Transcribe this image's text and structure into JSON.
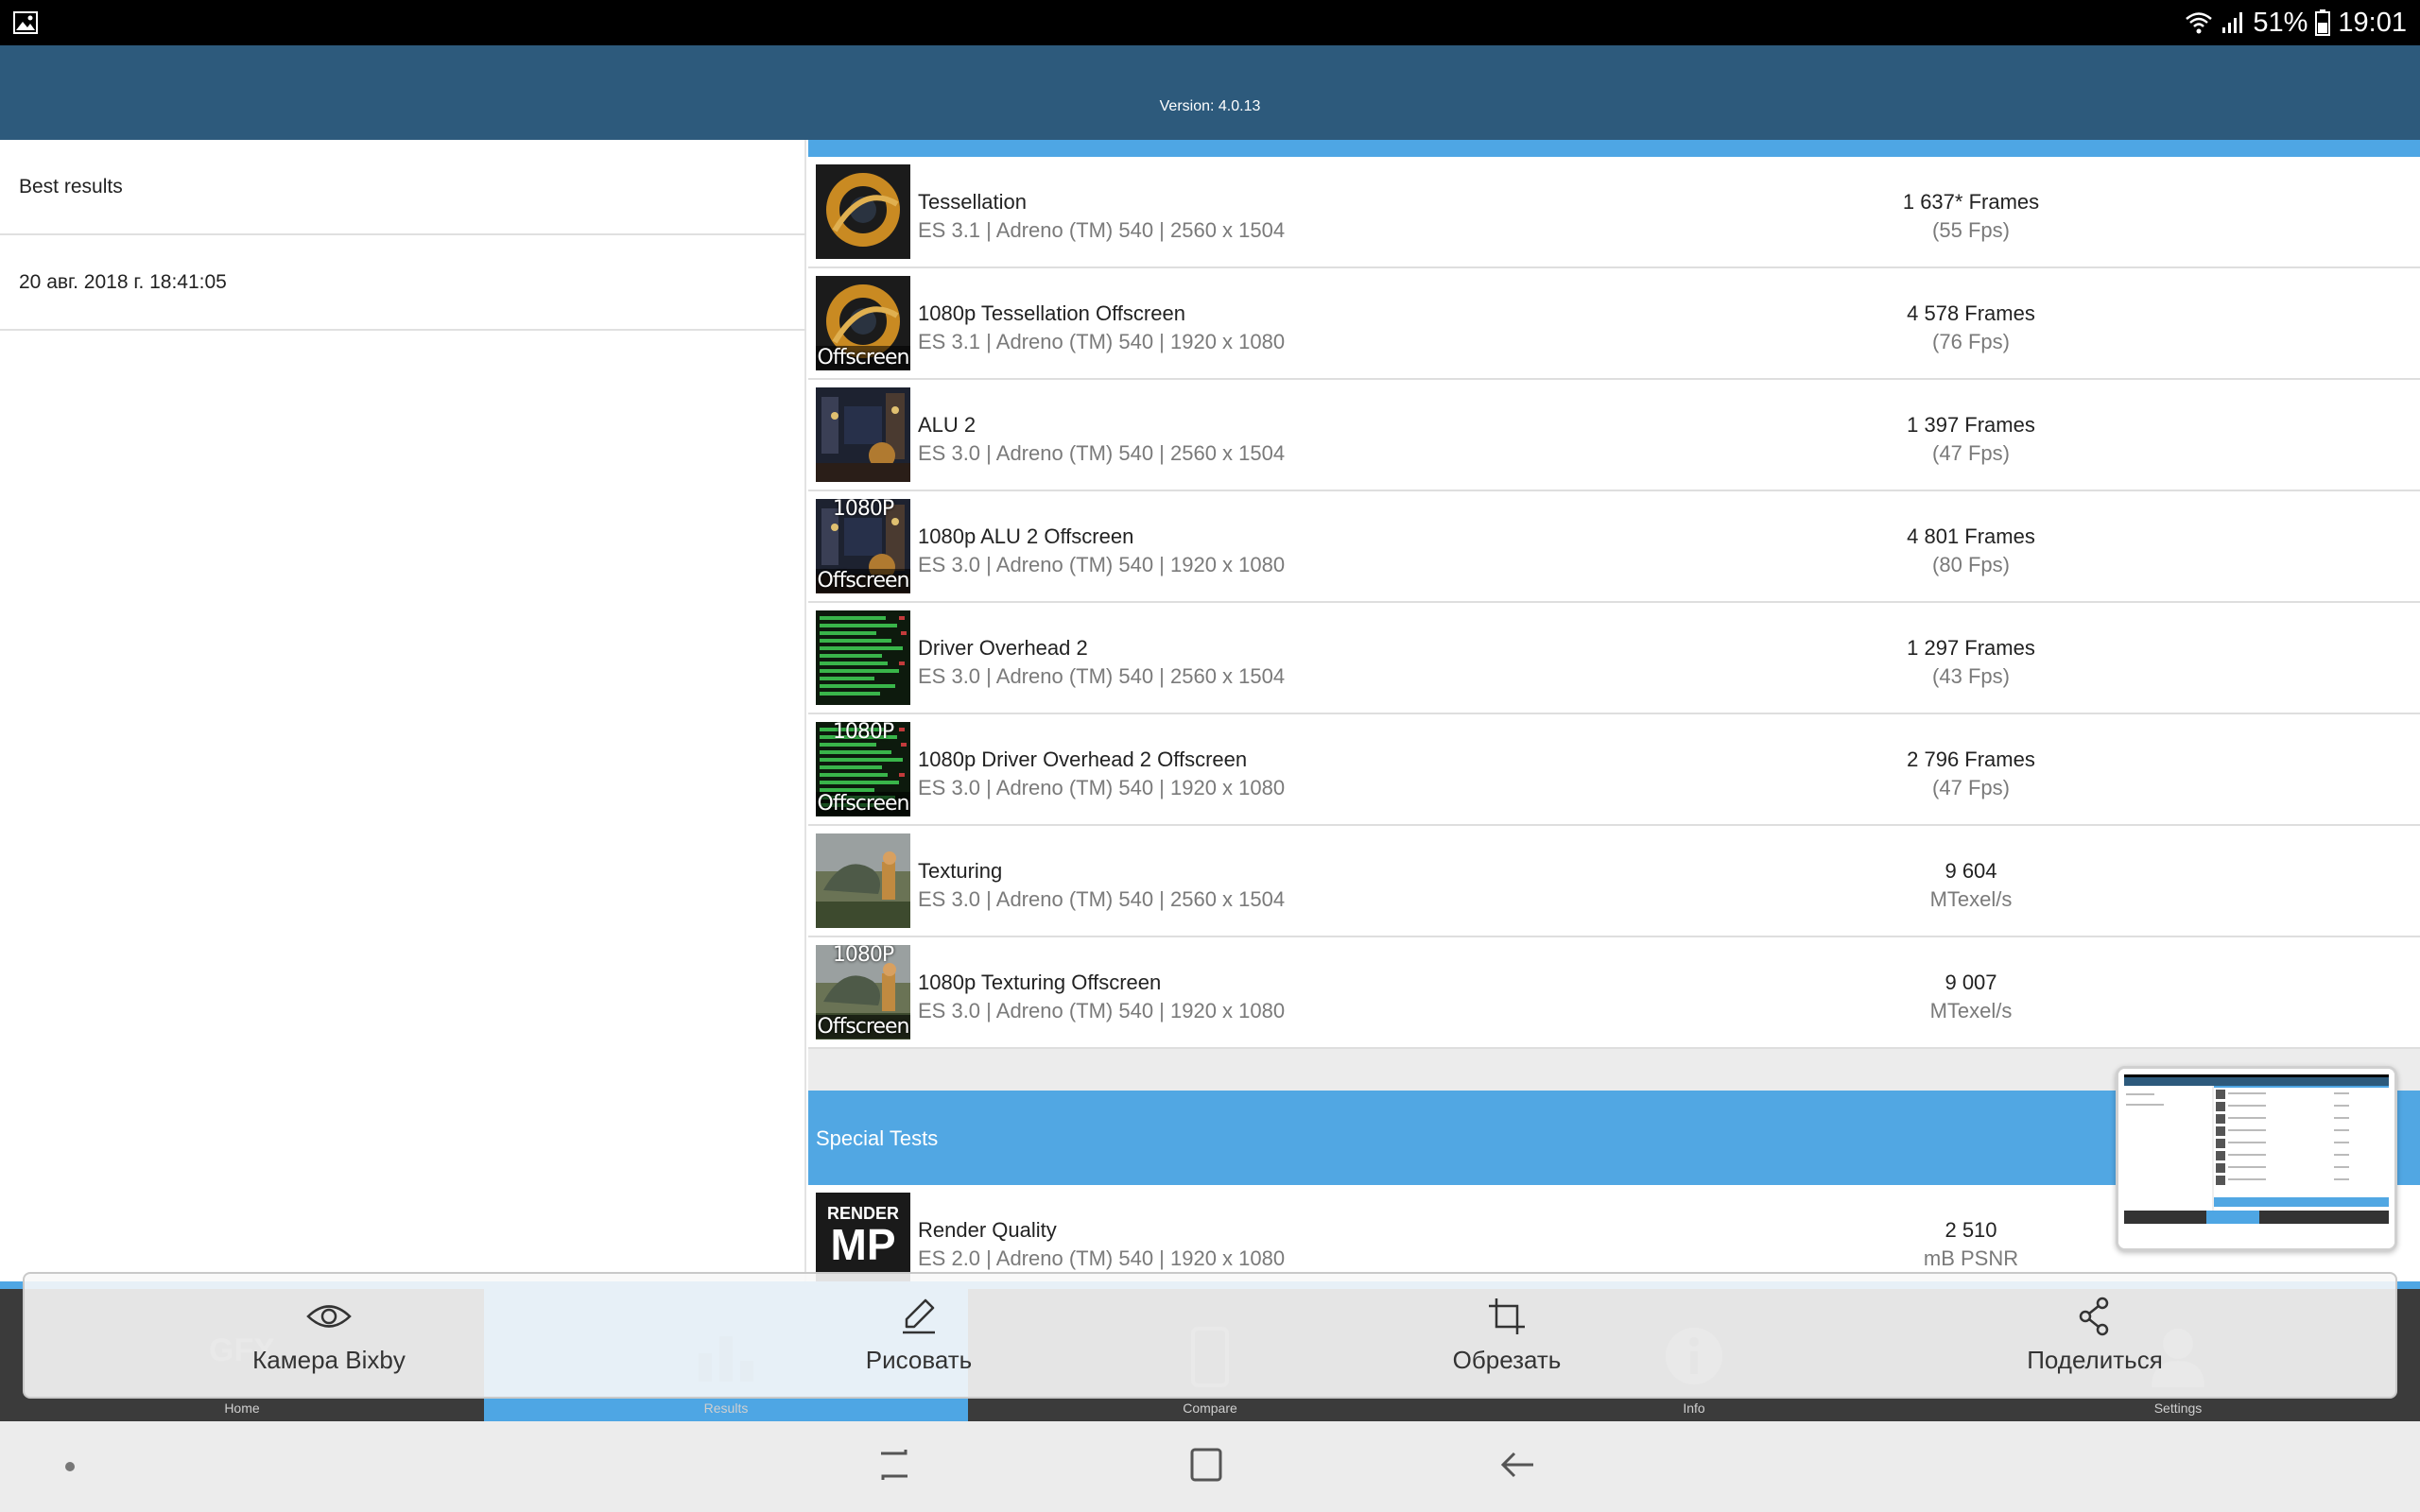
{
  "status_bar": {
    "battery": "51%",
    "time": "19:01",
    "icons": [
      "gallery-icon",
      "wifi-icon",
      "signal-icon",
      "battery-icon"
    ]
  },
  "header": {
    "version": "Version: 4.0.13"
  },
  "left_panel": {
    "title": "Best results",
    "session_date": "20 авг. 2018 г. 18:41:05"
  },
  "tests": [
    {
      "name": "Tessellation",
      "info": "ES 3.1 | Adreno (TM) 540 | 2560 x 1504",
      "score": "1 637* Frames",
      "sub": "(55 Fps)",
      "thumb": "tessellation",
      "thumb_top": "",
      "thumb_bottom": ""
    },
    {
      "name": "1080p Tessellation Offscreen",
      "info": "ES 3.1 | Adreno (TM) 540 | 1920 x 1080",
      "score": "4 578 Frames",
      "sub": "(76 Fps)",
      "thumb": "tessellation",
      "thumb_top": "",
      "thumb_bottom": "Offscreen"
    },
    {
      "name": "ALU 2",
      "info": "ES 3.0 | Adreno (TM) 540 | 2560 x 1504",
      "score": "1 397 Frames",
      "sub": "(47 Fps)",
      "thumb": "alu",
      "thumb_top": "",
      "thumb_bottom": ""
    },
    {
      "name": "1080p ALU 2 Offscreen",
      "info": "ES 3.0 | Adreno (TM) 540 | 1920 x 1080",
      "score": "4 801 Frames",
      "sub": "(80 Fps)",
      "thumb": "alu",
      "thumb_top": "1080P",
      "thumb_bottom": "Offscreen"
    },
    {
      "name": "Driver Overhead 2",
      "info": "ES 3.0 | Adreno (TM) 540 | 2560 x 1504",
      "score": "1 297 Frames",
      "sub": "(43 Fps)",
      "thumb": "driver",
      "thumb_top": "",
      "thumb_bottom": ""
    },
    {
      "name": "1080p Driver Overhead 2 Offscreen",
      "info": "ES 3.0 | Adreno (TM) 540 | 1920 x 1080",
      "score": "2 796 Frames",
      "sub": "(47 Fps)",
      "thumb": "driver",
      "thumb_top": "1080P",
      "thumb_bottom": "Offscreen"
    },
    {
      "name": "Texturing",
      "info": "ES 3.0 | Adreno (TM) 540 | 2560 x 1504",
      "score": "9 604",
      "sub": "MTexel/s",
      "thumb": "texturing",
      "thumb_top": "",
      "thumb_bottom": ""
    },
    {
      "name": "1080p Texturing Offscreen",
      "info": "ES 3.0 | Adreno (TM) 540 | 1920 x 1080",
      "score": "9 007",
      "sub": "MTexel/s",
      "thumb": "texturing",
      "thumb_top": "1080P",
      "thumb_bottom": "Offscreen"
    }
  ],
  "special": {
    "title": "Special Tests",
    "test": {
      "name": "Render Quality",
      "info": "ES 2.0 | Adreno (TM) 540 | 1920 x 1080",
      "score": "2 510",
      "sub": "mB PSNR",
      "thumb_top": "RENDER",
      "thumb_main": "MP"
    }
  },
  "app_nav": {
    "active_index": 1,
    "tabs": [
      {
        "label": "Home",
        "icon": "home-icon"
      },
      {
        "label": "Results",
        "icon": "bar-chart-icon"
      },
      {
        "label": "Compare",
        "icon": "phone-icon"
      },
      {
        "label": "Info",
        "icon": "info-icon"
      },
      {
        "label": "Settings",
        "icon": "user-icon"
      }
    ]
  },
  "screenshot_toolbar": {
    "bixby": "Камера Bixby",
    "draw": "Рисовать",
    "crop": "Обрезать",
    "share": "Поделиться"
  },
  "system_nav": {
    "keys": [
      "dot-icon",
      "recents-icon",
      "home-square-icon",
      "back-icon"
    ]
  }
}
